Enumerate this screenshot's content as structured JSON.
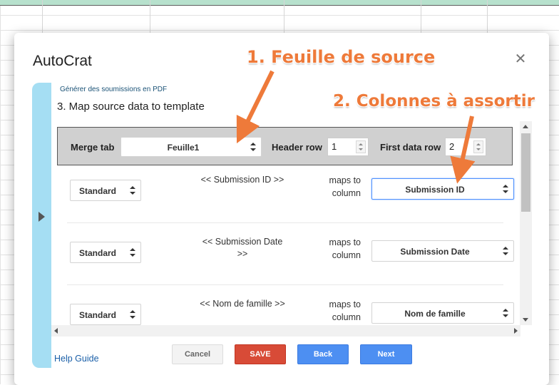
{
  "app": {
    "title": "AutoCrat",
    "close_icon": "close-icon"
  },
  "step": {
    "subtitle": "Générer des soumissions en PDF",
    "title": "3. Map source data to template"
  },
  "merge_bar": {
    "merge_tab_label": "Merge tab",
    "merge_tab_value": "Feuille1",
    "header_row_label": "Header row",
    "header_row_value": "1",
    "first_data_row_label": "First data row",
    "first_data_row_value": "2"
  },
  "mappings": [
    {
      "type": "Standard",
      "token_line1": "<< Submission ID >>",
      "token_line2": "",
      "maps_line1": "maps to",
      "maps_line2": "column",
      "column": "Submission ID"
    },
    {
      "type": "Standard",
      "token_line1": "<< Submission Date",
      "token_line2": ">>",
      "maps_line1": "maps to",
      "maps_line2": "column",
      "column": "Submission Date"
    },
    {
      "type": "Standard",
      "token_line1": "<< Nom de famille >>",
      "token_line2": "",
      "maps_line1": "maps to",
      "maps_line2": "column",
      "column": "Nom de famille"
    }
  ],
  "footer": {
    "help_label": "Help Guide",
    "cancel_label": "Cancel",
    "save_label": "SAVE",
    "back_label": "Back",
    "next_label": "Next"
  },
  "annotations": {
    "label_1": "1. Feuille de source",
    "label_2": "2. Colonnes à assortir",
    "color": "#ee7a3a"
  }
}
